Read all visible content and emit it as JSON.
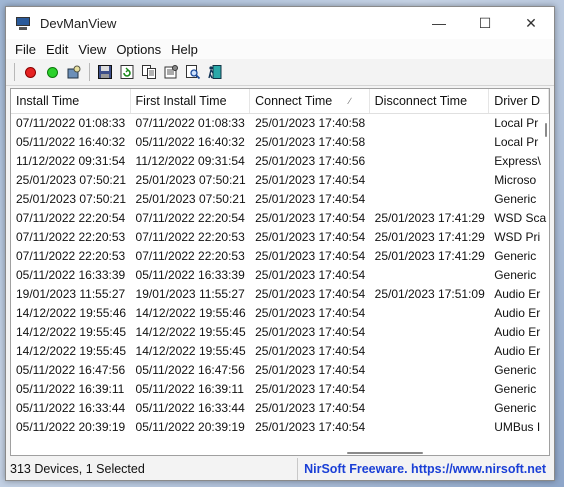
{
  "window": {
    "title": "DevManView"
  },
  "colors": {
    "link": "#1a3fd6",
    "stop": "#e52222",
    "start": "#2bd12b"
  },
  "menu": [
    "File",
    "Edit",
    "View",
    "Options",
    "Help"
  ],
  "toolbar": [
    "stop-red-icon",
    "start-green-icon",
    "properties-icon",
    "save-icon",
    "refresh-icon",
    "copy-icon",
    "html-report-icon",
    "find-icon",
    "exit-icon"
  ],
  "table": {
    "columns": [
      "Install Time",
      "First Install Time",
      "Connect Time",
      "Disconnect Time",
      "Driver D"
    ],
    "rows": [
      [
        "07/11/2022 01:08:33",
        "07/11/2022 01:08:33",
        "25/01/2023 17:40:58",
        "",
        "Local Pr"
      ],
      [
        "05/11/2022 16:40:32",
        "05/11/2022 16:40:32",
        "25/01/2023 17:40:58",
        "",
        "Local Pr"
      ],
      [
        "11/12/2022 09:31:54",
        "11/12/2022 09:31:54",
        "25/01/2023 17:40:56",
        "",
        "Express\\"
      ],
      [
        "25/01/2023 07:50:21",
        "25/01/2023 07:50:21",
        "25/01/2023 17:40:54",
        "",
        "Microso"
      ],
      [
        "25/01/2023 07:50:21",
        "25/01/2023 07:50:21",
        "25/01/2023 17:40:54",
        "",
        "Generic"
      ],
      [
        "07/11/2022 22:20:54",
        "07/11/2022 22:20:54",
        "25/01/2023 17:40:54",
        "25/01/2023 17:41:29",
        "WSD Sca"
      ],
      [
        "07/11/2022 22:20:53",
        "07/11/2022 22:20:53",
        "25/01/2023 17:40:54",
        "25/01/2023 17:41:29",
        "WSD Pri"
      ],
      [
        "07/11/2022 22:20:53",
        "07/11/2022 22:20:53",
        "25/01/2023 17:40:54",
        "25/01/2023 17:41:29",
        "Generic"
      ],
      [
        "05/11/2022 16:33:39",
        "05/11/2022 16:33:39",
        "25/01/2023 17:40:54",
        "",
        "Generic"
      ],
      [
        "19/01/2023 11:55:27",
        "19/01/2023 11:55:27",
        "25/01/2023 17:40:54",
        "25/01/2023 17:51:09",
        "Audio Er"
      ],
      [
        "14/12/2022 19:55:46",
        "14/12/2022 19:55:46",
        "25/01/2023 17:40:54",
        "",
        "Audio Er"
      ],
      [
        "14/12/2022 19:55:45",
        "14/12/2022 19:55:45",
        "25/01/2023 17:40:54",
        "",
        "Audio Er"
      ],
      [
        "14/12/2022 19:55:45",
        "14/12/2022 19:55:45",
        "25/01/2023 17:40:54",
        "",
        "Audio Er"
      ],
      [
        "05/11/2022 16:47:56",
        "05/11/2022 16:47:56",
        "25/01/2023 17:40:54",
        "",
        "Generic"
      ],
      [
        "05/11/2022 16:39:11",
        "05/11/2022 16:39:11",
        "25/01/2023 17:40:54",
        "",
        "Generic"
      ],
      [
        "05/11/2022 16:33:44",
        "05/11/2022 16:33:44",
        "25/01/2023 17:40:54",
        "",
        "Generic"
      ],
      [
        "05/11/2022 20:39:19",
        "05/11/2022 20:39:19",
        "25/01/2023 17:40:54",
        "",
        "UMBus I"
      ]
    ]
  },
  "status": {
    "count": "313 Devices, 1 Selected",
    "credit": "NirSoft Freeware. https://www.nirsoft.net"
  }
}
